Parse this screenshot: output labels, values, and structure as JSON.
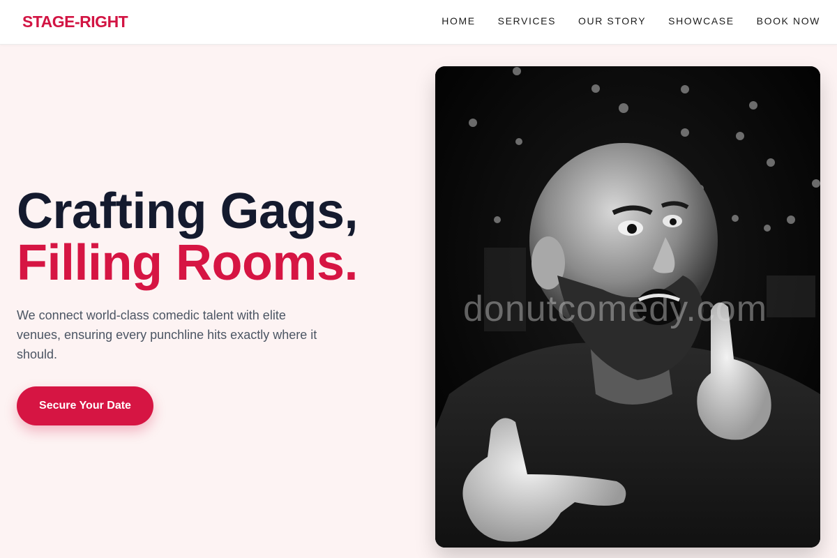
{
  "brand": {
    "name": "STAGE-RIGHT"
  },
  "nav": {
    "items": [
      {
        "label": "HOME"
      },
      {
        "label": "SERVICES"
      },
      {
        "label": "OUR STORY"
      },
      {
        "label": "SHOWCASE"
      },
      {
        "label": "BOOK NOW"
      }
    ]
  },
  "hero": {
    "heading_line1": "Crafting Gags,",
    "heading_line2": "Filling Rooms.",
    "subtext": "We connect world-class comedic talent with elite venues, ensuring every punchline hits exactly where it should.",
    "cta_label": "Secure Your Date",
    "image": {
      "watermark": "donutcomedy.com",
      "description_icon": "comedian-photo"
    }
  },
  "colors": {
    "accent": "#d61543",
    "heading": "#141a2e",
    "background": "#fdf3f3",
    "body_text": "#4b5563"
  }
}
